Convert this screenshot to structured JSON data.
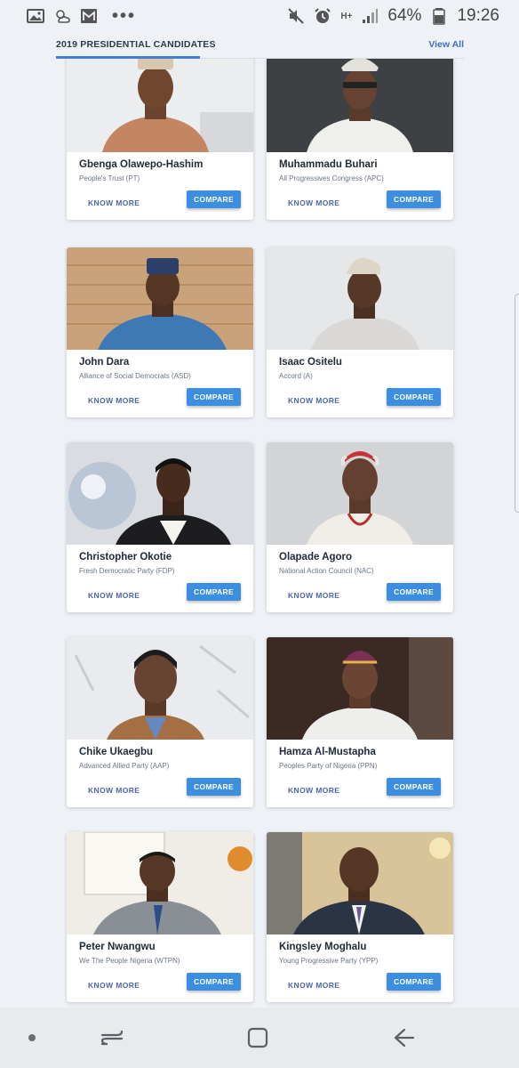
{
  "status_bar": {
    "battery": "64%",
    "time": "19:26",
    "network": "H+"
  },
  "header": {
    "title": "2019 PRESIDENTIAL CANDIDATES",
    "view_all": "View All"
  },
  "actions": {
    "know_more": "KNOW MORE",
    "compare": "COMPARE"
  },
  "candidates": [
    {
      "name": "Gbenga Olawepo-Hashim",
      "party": "People's Trust (PT)"
    },
    {
      "name": "Muhammadu Buhari",
      "party": "All Progressives Congress (APC)"
    },
    {
      "name": "John Dara",
      "party": "Alliance of Social Democrats (ASD)"
    },
    {
      "name": "Isaac Ositelu",
      "party": "Accord (A)"
    },
    {
      "name": "Christopher Okotie",
      "party": "Fresh Democratic Party (FDP)"
    },
    {
      "name": "Olapade Agoro",
      "party": "National Action Council (NAC)"
    },
    {
      "name": "Chike Ukaegbu",
      "party": "Advanced Allied Party (AAP)"
    },
    {
      "name": "Hamza Al-Mustapha",
      "party": "Peoples Party of Nigeria (PPN)"
    },
    {
      "name": "Peter Nwangwu",
      "party": "We The People Nigeria (WTPN)"
    },
    {
      "name": "Kingsley Moghalu",
      "party": "Young Progressive Party (YPP)"
    }
  ]
}
